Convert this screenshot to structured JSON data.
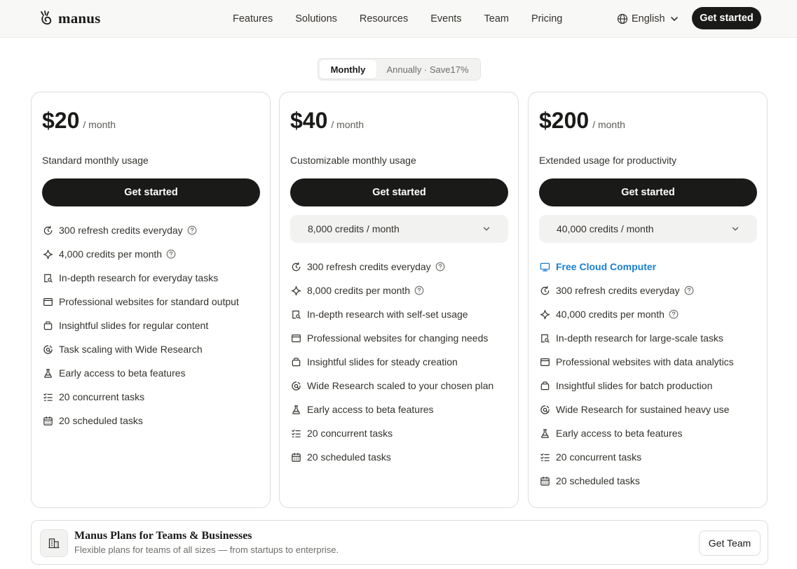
{
  "header": {
    "brand": "manus",
    "nav": [
      "Features",
      "Solutions",
      "Resources",
      "Events",
      "Team",
      "Pricing"
    ],
    "language": "English",
    "cta": "Get started"
  },
  "billing_toggle": {
    "monthly": "Monthly",
    "annually": "Annually · Save17%",
    "selected": "Monthly"
  },
  "plans": [
    {
      "price": "$20",
      "period": "/ month",
      "description": "Standard monthly usage",
      "button": "Get started",
      "features": [
        {
          "icon": "refresh-icon",
          "text": "300 refresh credits everyday",
          "help": true
        },
        {
          "icon": "sparkle-icon",
          "text": "4,000 credits per month",
          "help": true
        },
        {
          "icon": "research-icon",
          "text": "In-depth research for everyday tasks"
        },
        {
          "icon": "browser-icon",
          "text": "Professional websites for standard output"
        },
        {
          "icon": "slides-icon",
          "text": "Insightful slides for regular content"
        },
        {
          "icon": "wide-research-icon",
          "text": "Task scaling with Wide Research"
        },
        {
          "icon": "flask-icon",
          "text": "Early access to beta features"
        },
        {
          "icon": "checklist-icon",
          "text": "20 concurrent tasks"
        },
        {
          "icon": "calendar-icon",
          "text": "20 scheduled tasks"
        }
      ]
    },
    {
      "price": "$40",
      "period": "/ month",
      "description": "Customizable monthly usage",
      "button": "Get started",
      "credit_select": "8,000 credits / month",
      "features": [
        {
          "icon": "refresh-icon",
          "text": "300 refresh credits everyday",
          "help": true
        },
        {
          "icon": "sparkle-icon",
          "text": "8,000 credits per month",
          "help": true
        },
        {
          "icon": "research-icon",
          "text": "In-depth research with self-set usage"
        },
        {
          "icon": "browser-icon",
          "text": "Professional websites for changing needs"
        },
        {
          "icon": "slides-icon",
          "text": "Insightful slides for steady creation"
        },
        {
          "icon": "wide-research-icon",
          "text": "Wide Research scaled to your chosen plan"
        },
        {
          "icon": "flask-icon",
          "text": "Early access to beta features"
        },
        {
          "icon": "checklist-icon",
          "text": "20 concurrent tasks"
        },
        {
          "icon": "calendar-icon",
          "text": "20 scheduled tasks"
        }
      ]
    },
    {
      "price": "$200",
      "period": "/ month",
      "description": "Extended usage for productivity",
      "button": "Get started",
      "credit_select": "40,000 credits / month",
      "features": [
        {
          "icon": "monitor-icon",
          "text": "Free Cloud Computer",
          "highlight": true
        },
        {
          "icon": "refresh-icon",
          "text": "300 refresh credits everyday",
          "help": true
        },
        {
          "icon": "sparkle-icon",
          "text": "40,000 credits per month",
          "help": true
        },
        {
          "icon": "research-icon",
          "text": "In-depth research for large-scale tasks"
        },
        {
          "icon": "browser-icon",
          "text": "Professional websites with data analytics"
        },
        {
          "icon": "slides-icon",
          "text": "Insightful slides for batch production"
        },
        {
          "icon": "wide-research-icon",
          "text": "Wide Research for sustained heavy use"
        },
        {
          "icon": "flask-icon",
          "text": "Early access to beta features"
        },
        {
          "icon": "checklist-icon",
          "text": "20 concurrent tasks"
        },
        {
          "icon": "calendar-icon",
          "text": "20 scheduled tasks"
        }
      ]
    }
  ],
  "teams": {
    "title": "Manus Plans for Teams & Businesses",
    "subtitle": "Flexible plans for teams of all sizes — from startups to enterprise.",
    "button": "Get Team"
  },
  "colors": {
    "accent_dark": "#1a1a19",
    "highlight_blue": "#1a7fd1",
    "header_bg": "#f8f8f7"
  }
}
